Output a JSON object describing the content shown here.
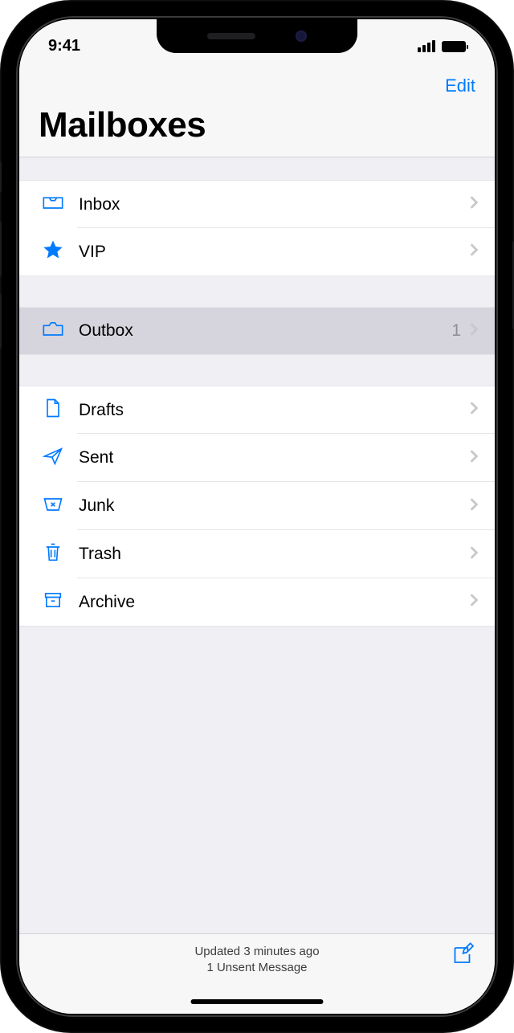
{
  "statusBar": {
    "time": "9:41"
  },
  "nav": {
    "editLabel": "Edit",
    "title": "Mailboxes"
  },
  "group1": {
    "inbox": "Inbox",
    "vip": "VIP"
  },
  "group2": {
    "outbox": "Outbox",
    "outboxCount": "1"
  },
  "group3": {
    "drafts": "Drafts",
    "sent": "Sent",
    "junk": "Junk",
    "trash": "Trash",
    "archive": "Archive"
  },
  "toolbar": {
    "status1": "Updated 3 minutes ago",
    "status2": "1 Unsent Message"
  }
}
